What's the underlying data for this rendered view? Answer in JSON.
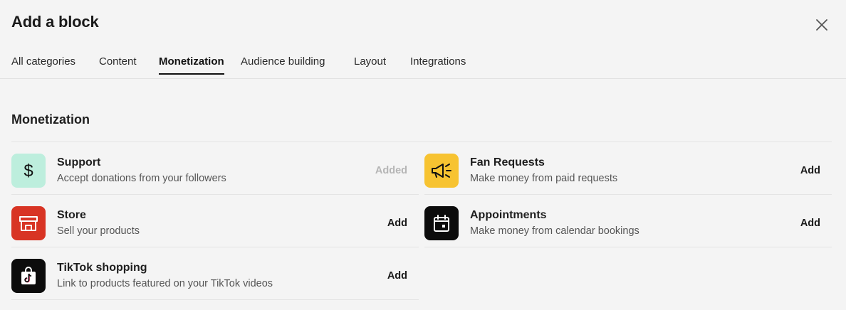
{
  "dialog": {
    "title": "Add a block"
  },
  "tabs": [
    {
      "label": "All categories"
    },
    {
      "label": "Content"
    },
    {
      "label": "Monetization"
    },
    {
      "label": "Audience building"
    },
    {
      "label": "Layout"
    },
    {
      "label": "Integrations"
    }
  ],
  "active_tab": "Monetization",
  "section": {
    "title": "Monetization"
  },
  "blocks": [
    {
      "name": "Support",
      "description": "Accept donations from your followers",
      "action": "Added",
      "icon": "dollar-icon",
      "icon_bg": "#bdeedd"
    },
    {
      "name": "Fan Requests",
      "description": "Make money from paid requests",
      "action": "Add",
      "icon": "megaphone-icon",
      "icon_bg": "#f7c331"
    },
    {
      "name": "Store",
      "description": "Sell your products",
      "action": "Add",
      "icon": "storefront-icon",
      "icon_bg": "#d83424"
    },
    {
      "name": "Appointments",
      "description": "Make money from calendar bookings",
      "action": "Add",
      "icon": "calendar-icon",
      "icon_bg": "#0c0c0c"
    },
    {
      "name": "TikTok shopping",
      "description": "Link to products featured on your TikTok videos",
      "action": "Add",
      "icon": "tiktok-bag-icon",
      "icon_bg": "#0c0c0c"
    }
  ]
}
